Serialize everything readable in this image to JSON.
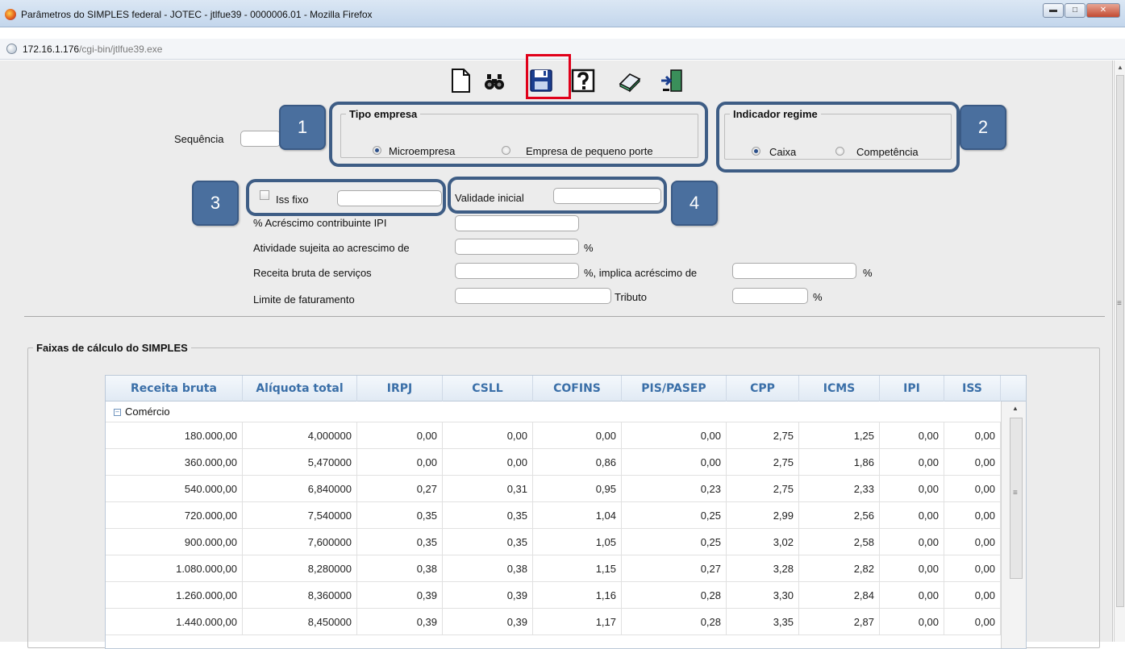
{
  "window": {
    "title": "Parâmetros do SIMPLES federal - JOTEC - jtlfue39 - 0000006.01 - Mozilla Firefox",
    "url_host": "172.16.1.176",
    "url_path": "/cgi-bin/jtlfue39.exe"
  },
  "toolbar": {
    "buttons": [
      {
        "icon": "new-document-icon"
      },
      {
        "icon": "binoculars-icon"
      },
      {
        "icon": "floppy-disk-icon"
      },
      {
        "icon": "help-icon"
      },
      {
        "icon": "eraser-icon"
      },
      {
        "icon": "exit-door-icon"
      }
    ]
  },
  "form": {
    "sequencia_label": "Sequência",
    "sequencia_value": "",
    "tipo_empresa": {
      "legend": "Tipo empresa",
      "options": [
        "Microempresa",
        "Empresa de pequeno porte"
      ],
      "selected": "Microempresa"
    },
    "indicador_regime": {
      "legend": "Indicador regime",
      "options": [
        "Caixa",
        "Competência"
      ],
      "selected": "Caixa"
    },
    "iss_fixo_label": "Iss fixo",
    "iss_fixo_value": "",
    "validade_inicial_label": "Validade inicial",
    "validade_inicial_value": "",
    "acrescimo_ipi_label": "% Acréscimo contribuinte IPI",
    "acrescimo_ipi_value": "",
    "atividade_label": "Atividade sujeita ao acrescimo de",
    "atividade_value": "",
    "percent_sign": "%",
    "receita_servicos_label": "Receita bruta de serviços",
    "receita_servicos_value": "",
    "implica_label": "%, implica acréscimo de",
    "implica_value": "",
    "limite_label": "Limite de faturamento",
    "limite_value": "",
    "tributo_label": "Tributo",
    "tributo_value": ""
  },
  "callouts": [
    "1",
    "2",
    "3",
    "4"
  ],
  "faixas": {
    "legend": "Faixas de cálculo do SIMPLES",
    "columns": [
      "Receita bruta",
      "Alíquota total",
      "IRPJ",
      "CSLL",
      "COFINS",
      "PIS/PASEP",
      "CPP",
      "ICMS",
      "IPI",
      "ISS"
    ],
    "group": "Comércio",
    "rows": [
      [
        "180.000,00",
        "4,000000",
        "0,00",
        "0,00",
        "0,00",
        "0,00",
        "2,75",
        "1,25",
        "0,00",
        "0,00"
      ],
      [
        "360.000,00",
        "5,470000",
        "0,00",
        "0,00",
        "0,86",
        "0,00",
        "2,75",
        "1,86",
        "0,00",
        "0,00"
      ],
      [
        "540.000,00",
        "6,840000",
        "0,27",
        "0,31",
        "0,95",
        "0,23",
        "2,75",
        "2,33",
        "0,00",
        "0,00"
      ],
      [
        "720.000,00",
        "7,540000",
        "0,35",
        "0,35",
        "1,04",
        "0,25",
        "2,99",
        "2,56",
        "0,00",
        "0,00"
      ],
      [
        "900.000,00",
        "7,600000",
        "0,35",
        "0,35",
        "1,05",
        "0,25",
        "3,02",
        "2,58",
        "0,00",
        "0,00"
      ],
      [
        "1.080.000,00",
        "8,280000",
        "0,38",
        "0,38",
        "1,15",
        "0,27",
        "3,28",
        "2,82",
        "0,00",
        "0,00"
      ],
      [
        "1.260.000,00",
        "8,360000",
        "0,39",
        "0,39",
        "1,16",
        "0,28",
        "3,30",
        "2,84",
        "0,00",
        "0,00"
      ],
      [
        "1.440.000,00",
        "8,450000",
        "0,39",
        "0,39",
        "1,17",
        "0,28",
        "3,35",
        "2,87",
        "0,00",
        "0,00"
      ]
    ]
  }
}
